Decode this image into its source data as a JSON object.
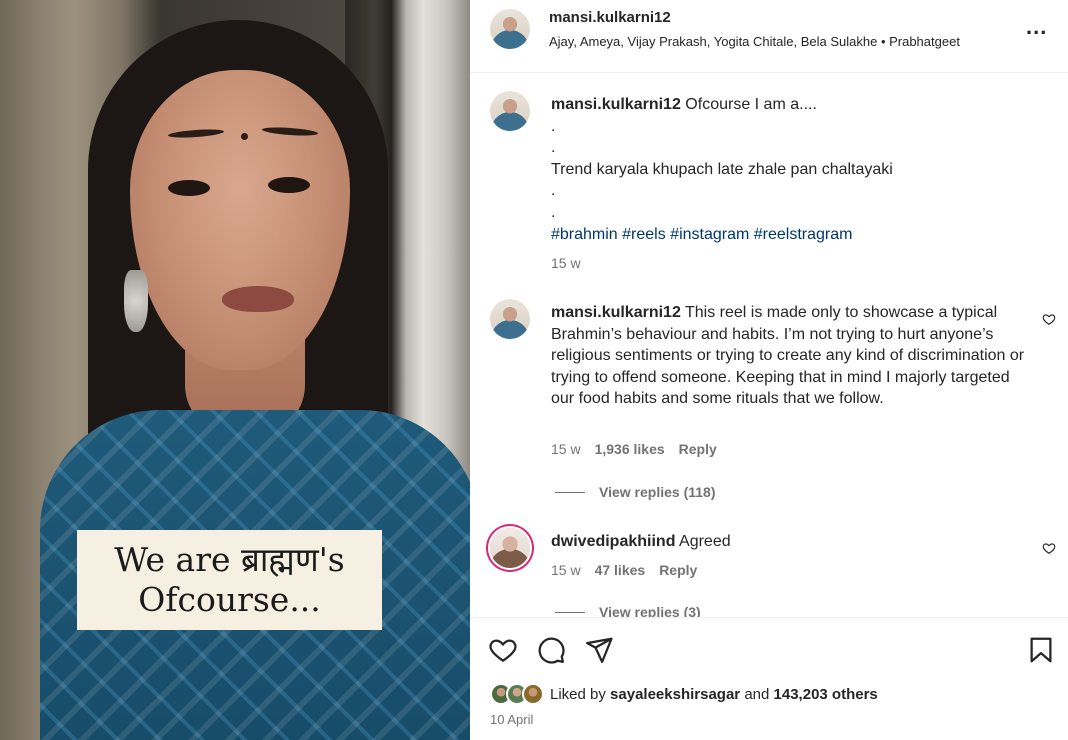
{
  "post": {
    "username": "mansi.kulkarni12",
    "audio": "Ajay, Ameya, Vijay Prakash, Yogita Chitale, Bela Sulakhe • Prabhatgeet",
    "more_label": "..."
  },
  "media": {
    "overlay_line1": "We are ब्राह्मण's",
    "overlay_line2": "Ofcourse..."
  },
  "caption": {
    "username": "mansi.kulkarni12",
    "line1": "Ofcourse I am a....",
    "dot1": ".",
    "dot2": ".",
    "line2": "Trend karyala khupach late zhale pan chaltayaki",
    "dot3": ".",
    "dot4": ".",
    "hashtags": "#brahmin #reels #instagram #reelstragram",
    "time": "15 w"
  },
  "comments": [
    {
      "username": "mansi.kulkarni12",
      "text": "This reel is made only to showcase a typical Brahmin’s behaviour and habits. I’m not trying to hurt anyone’s religious sentiments or trying to create any kind of discrimination or trying to offend someone. Keeping that in mind I majorly targeted our food habits and some rituals that we follow.",
      "time": "15 w",
      "likes": "1,936 likes",
      "reply": "Reply",
      "view_replies": "View replies (118)"
    },
    {
      "username": "dwivedipakhiind",
      "text": "Agreed",
      "time": "15 w",
      "likes": "47 likes",
      "reply": "Reply",
      "view_replies": "View replies (3)"
    }
  ],
  "likes_summary": {
    "prefix": "Liked by",
    "user": "sayaleekshirsagar",
    "and": "and",
    "others": "143,203 others"
  },
  "date": "10 April",
  "icons": {
    "like": "heart-icon",
    "comment": "comment-icon",
    "share": "share-icon",
    "save": "bookmark-icon",
    "more": "more-icon",
    "comment_like": "small-heart-icon"
  },
  "colors": {
    "text": "#262626",
    "muted": "#737373",
    "hashtag": "#00376b",
    "story_ring": "#d62976"
  }
}
